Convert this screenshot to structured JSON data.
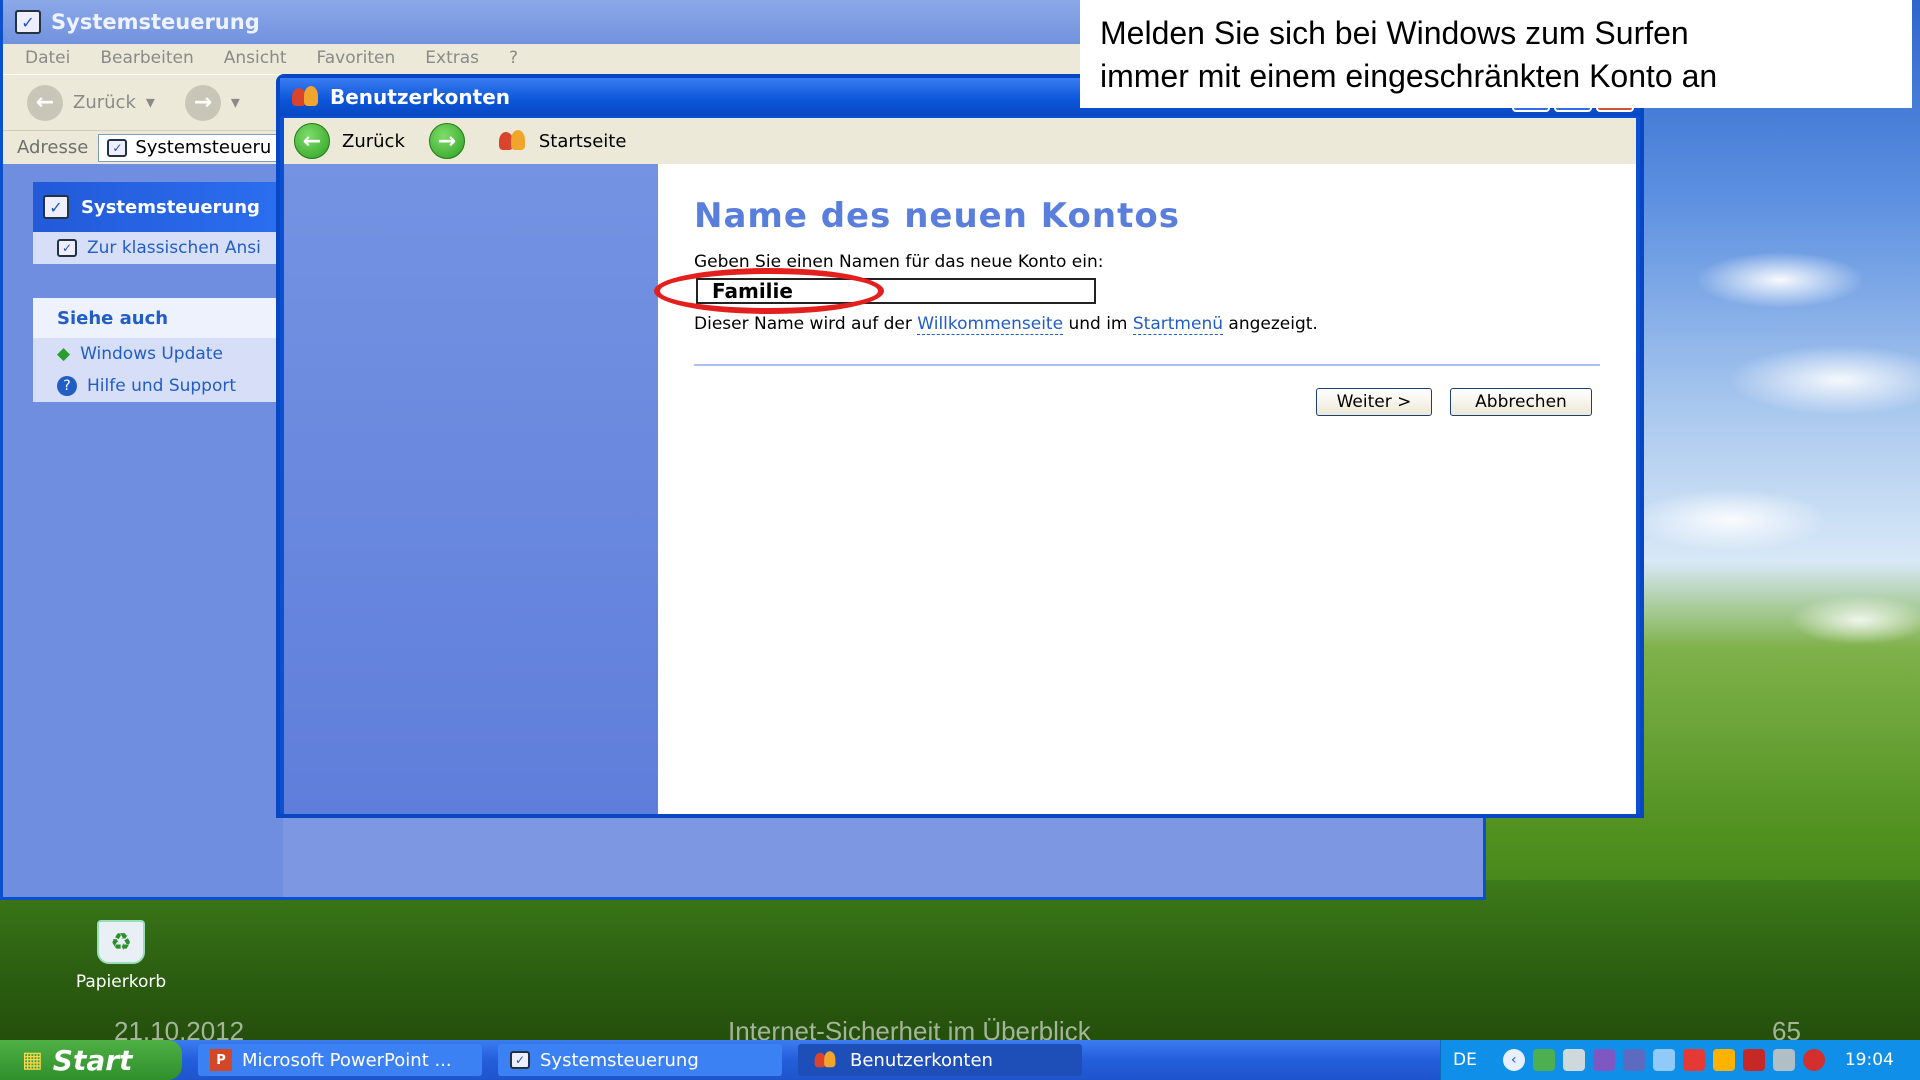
{
  "controlpanel": {
    "title": "Systemsteuerung",
    "menu": [
      "Datei",
      "Bearbeiten",
      "Ansicht",
      "Favoriten",
      "Extras",
      "?"
    ],
    "back_label": "Zurück",
    "address_label": "Adresse",
    "address_value": "Systemsteueru",
    "sidebar_title": "Systemsteuerung",
    "classic_view": "Zur klassischen Ansi",
    "see_also": "Siehe auch",
    "links": [
      "Windows Update",
      "Hilfe und Support"
    ]
  },
  "accounts": {
    "title": "Benutzerkonten",
    "back_label": "Zurück",
    "home_label": "Startseite",
    "heading": "Name des neuen Kontos",
    "prompt": "Geben Sie einen Namen für das neue Konto ein:",
    "name_value": "Familie",
    "hint_prefix": "Dieser Name wird auf der",
    "hint_link1": "Willkommenseite",
    "hint_mid": "und im",
    "hint_link2": "Startmenü",
    "hint_suffix": "angezeigt.",
    "next_label": "Weiter >",
    "cancel_label": "Abbrechen"
  },
  "callout": {
    "line1": "Melden Sie sich bei Windows zum Surfen",
    "line2": "immer mit einem eingeschränkten Konto an"
  },
  "desktop": {
    "recycle_bin": "Papierkorb"
  },
  "footer": {
    "date": "21.10.2012",
    "title": "Internet-Sicherheit im Überblick",
    "page": "65"
  },
  "taskbar": {
    "start": "Start",
    "tasks": [
      "Microsoft PowerPoint ...",
      "Systemsteuerung",
      "Benutzerkonten"
    ],
    "lang": "DE",
    "clock": "19:04"
  },
  "colors": {
    "highlight_ellipse": "#e4201f",
    "xp_blue": "#0a50d0",
    "heading": "#5a7edc"
  }
}
